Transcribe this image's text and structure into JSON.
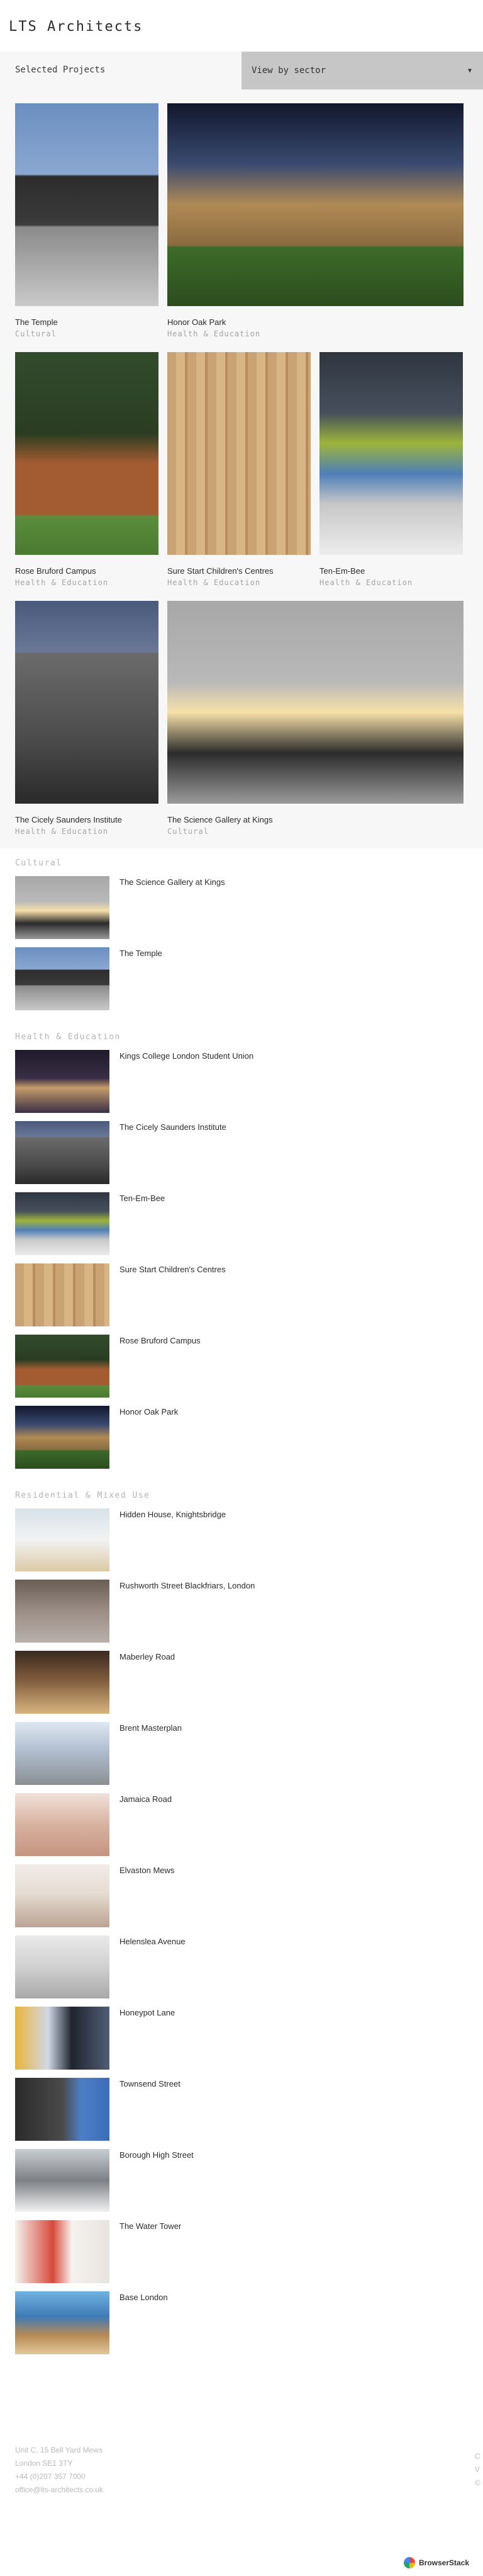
{
  "site": {
    "logo": "LTS Architects"
  },
  "grid": {
    "heading": "Selected Projects",
    "sector_select": {
      "value": "View by sector",
      "icon": "caret-down-icon"
    },
    "rows": [
      [
        {
          "title": "The Temple",
          "sector": "Cultural",
          "image": "img-temple"
        },
        {
          "title": "Honor Oak Park",
          "sector": "Health & Education",
          "image": "img-honor"
        }
      ],
      [
        {
          "title": "Rose Bruford Campus",
          "sector": "Health & Education",
          "image": "img-rose"
        },
        {
          "title": "Sure Start Children's Centres",
          "sector": "Health & Education",
          "image": "img-surestart"
        },
        {
          "title": "Ten-Em-Bee",
          "sector": "Health & Education",
          "image": "img-tenembee"
        }
      ],
      [
        {
          "title": "The Cicely Saunders Institute",
          "sector": "Health & Education",
          "image": "img-cicely"
        },
        {
          "title": "The Science Gallery at Kings",
          "sector": "Cultural",
          "image": "img-science"
        }
      ]
    ]
  },
  "sectors": [
    {
      "heading": "Cultural",
      "items": [
        {
          "label": "The Science Gallery at Kings",
          "image": "img-science"
        },
        {
          "label": "The Temple",
          "image": "img-temple"
        }
      ]
    },
    {
      "heading": "Health & Education",
      "items": [
        {
          "label": "Kings College London Student Union",
          "image": "img-kings"
        },
        {
          "label": "The Cicely Saunders Institute",
          "image": "img-cicely"
        },
        {
          "label": "Ten-Em-Bee",
          "image": "img-tenembee"
        },
        {
          "label": "Sure Start Children's Centres",
          "image": "img-surestart"
        },
        {
          "label": "Rose Bruford Campus",
          "image": "img-rose"
        },
        {
          "label": "Honor Oak Park",
          "image": "img-honor"
        }
      ]
    },
    {
      "heading": "Residential & Mixed Use",
      "items": [
        {
          "label": "Hidden House, Knightsbridge",
          "image": "img-hidden"
        },
        {
          "label": "Rushworth Street Blackfriars, London",
          "image": "img-rushworth"
        },
        {
          "label": "Maberley Road",
          "image": "img-maberley"
        },
        {
          "label": "Brent Masterplan",
          "image": "img-brent"
        },
        {
          "label": "Jamaica Road",
          "image": "img-jamaica"
        },
        {
          "label": "Elvaston Mews",
          "image": "img-elvaston"
        },
        {
          "label": "Helenslea Avenue",
          "image": "img-helenslea"
        },
        {
          "label": "Honeypot Lane",
          "image": "img-honeypot"
        },
        {
          "label": "Townsend Street",
          "image": "img-townsend"
        },
        {
          "label": "Borough High Street",
          "image": "img-borough"
        },
        {
          "label": "The Water Tower",
          "image": "img-watertower"
        },
        {
          "label": "Base London",
          "image": "img-base"
        }
      ]
    }
  ],
  "footer": {
    "address_line1": "Unit C, 15 Bell Yard Mews",
    "address_line2": "London SE1 3TY",
    "phone": "+44 (0)207 357 7000",
    "email": "office@lts-architects.co.uk",
    "right_col": [
      "C",
      "V",
      "",
      "©"
    ]
  },
  "badge": {
    "label": "BrowserStack"
  }
}
